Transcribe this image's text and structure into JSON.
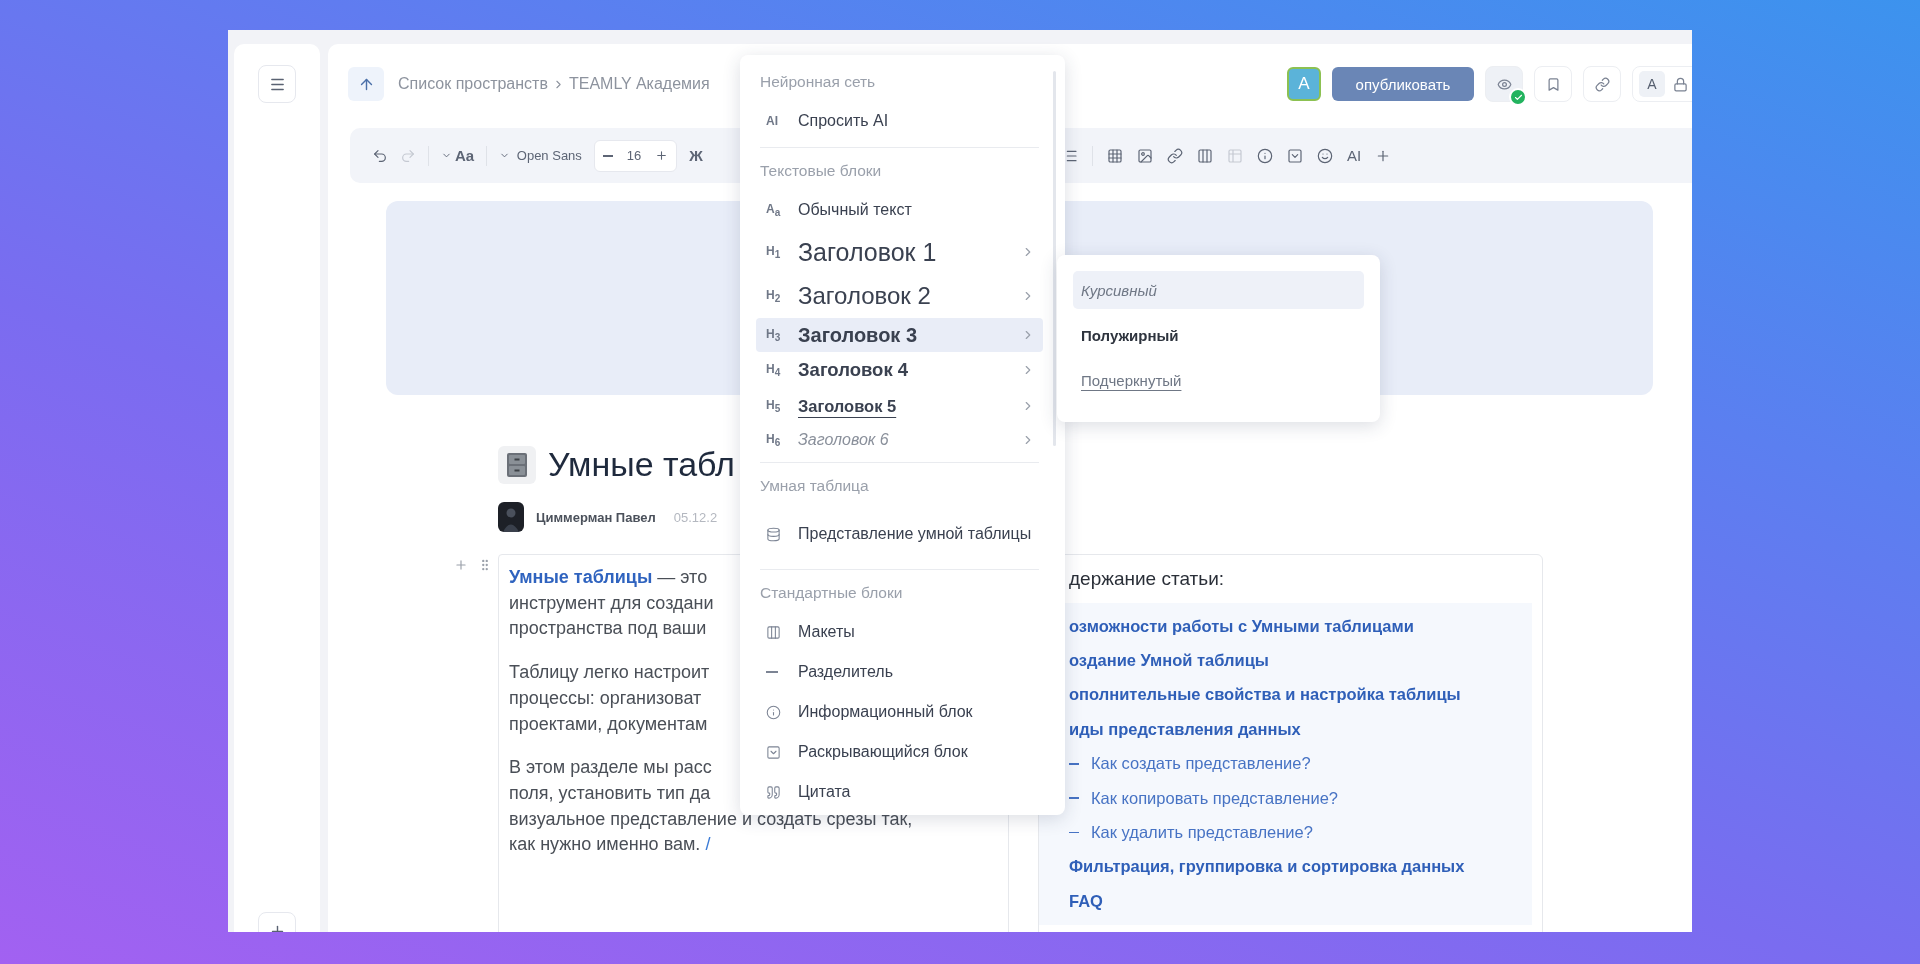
{
  "sidebar": {
    "buttons": [
      {
        "kind": "menu"
      },
      {
        "kind": "add"
      }
    ]
  },
  "breadcrumb": {
    "items": [
      "Список пространств",
      "TEAMLY Академия"
    ]
  },
  "header": {
    "avatar": "A",
    "publish": "опубликовать",
    "tools": [
      {
        "kind": "preview",
        "confirmed": true
      },
      {
        "kind": "bookmark",
        "confirmed": false
      },
      {
        "kind": "link",
        "confirmed": false
      }
    ],
    "chip": {
      "label": "A"
    }
  },
  "toolbar": {
    "left": [
      {
        "kind": "undo",
        "disabled": false
      },
      {
        "kind": "redo",
        "disabled": true
      },
      {
        "kind": "separator"
      },
      {
        "kind": "text-style",
        "label": "Aa",
        "disabled": false
      },
      {
        "kind": "separator"
      },
      {
        "kind": "font",
        "label": "Open Sans",
        "disabled": false
      },
      {
        "kind": "size",
        "value": "16",
        "disabled": false
      },
      {
        "kind": "bold",
        "label": "Ж",
        "disabled": false
      }
    ],
    "right": [
      {
        "kind": "list",
        "disabled": false
      },
      {
        "kind": "separator"
      },
      {
        "kind": "table",
        "disabled": false
      },
      {
        "kind": "image",
        "disabled": false
      },
      {
        "kind": "link",
        "disabled": false
      },
      {
        "kind": "columns",
        "disabled": false
      },
      {
        "kind": "grid",
        "disabled": true
      },
      {
        "kind": "info",
        "disabled": false
      },
      {
        "kind": "collapse",
        "disabled": false
      },
      {
        "kind": "emoji",
        "disabled": false
      },
      {
        "kind": "ai",
        "label": "AI",
        "disabled": false
      },
      {
        "kind": "plus",
        "disabled": false
      }
    ]
  },
  "article": {
    "title": "Умные табл",
    "author": "Циммерман Павел",
    "date": "05.12.2",
    "paragraphs": [
      {
        "link": "Умные таблицы",
        "lines": [
          "— это",
          "инструмент для создани",
          "пространства под ваши"
        ]
      },
      {
        "lines": [
          "Таблицу легко настроит",
          "процессы: организоват",
          "проектами, документам"
        ]
      },
      {
        "lines": [
          "В этом разделе мы расс",
          "поля, установить тип да",
          "визуальное представление и создать срезы так,",
          "как нужно именно вам."
        ],
        "typed": "/"
      }
    ]
  },
  "toc": {
    "title": "держание статьи:",
    "items": [
      {
        "label": "озможности работы с Умными таблицами"
      },
      {
        "label": "оздание Умной таблицы"
      },
      {
        "label": "ополнительные свойства и настройка таблицы"
      },
      {
        "label": "иды представления данных",
        "children": [
          {
            "label": "Как создать представление?"
          },
          {
            "label": "Как копировать представление?"
          },
          {
            "label": "Как удалить представление?"
          }
        ]
      },
      {
        "label": "Фильтрация, группировка и сортировка данных"
      },
      {
        "label": "FAQ"
      }
    ]
  },
  "block_menu": {
    "sections": [
      {
        "title": "Нейронная сеть",
        "items": [
          {
            "kind": "ai",
            "glyph": "AI",
            "label": "Спросить AI",
            "submenu": false,
            "selected": false
          }
        ]
      },
      {
        "title": "Текстовые блоки",
        "items": [
          {
            "kind": "text",
            "glyph": "A$_{a}$",
            "label": "Обычный текст",
            "submenu": false,
            "selected": false
          },
          {
            "kind": "h1",
            "glyph": "H$_{1}$",
            "label": "Заголовок 1",
            "submenu": true,
            "selected": false
          },
          {
            "kind": "h2",
            "glyph": "H$_{2}$",
            "label": "Заголовок 2",
            "submenu": true,
            "selected": false
          },
          {
            "kind": "h3",
            "glyph": "H$_{3}$",
            "label": "Заголовок 3",
            "submenu": true,
            "selected": true
          },
          {
            "kind": "h4",
            "glyph": "H$_{4}$",
            "label": "Заголовок 4",
            "submenu": true,
            "selected": false
          },
          {
            "kind": "h5",
            "glyph": "H$_{5}$",
            "label": "Заголовок 5",
            "submenu": true,
            "selected": false
          },
          {
            "kind": "h6",
            "glyph": "H$_{6}$",
            "label": "Заголовок 6",
            "submenu": true,
            "selected": false
          }
        ]
      },
      {
        "title": "Умная таблица",
        "items": [
          {
            "kind": "database",
            "label": "Представление умной таблицы",
            "submenu": false,
            "selected": false
          }
        ]
      },
      {
        "title": "Стандартные блоки",
        "items": [
          {
            "kind": "layouts",
            "label": "Макеты",
            "submenu": false,
            "selected": false
          },
          {
            "kind": "divider",
            "label": "Разделитель",
            "submenu": false,
            "selected": false
          },
          {
            "kind": "info",
            "label": "Информационный блок",
            "submenu": false,
            "selected": false
          },
          {
            "kind": "collapse",
            "label": "Раскрывающийся блок",
            "submenu": false,
            "selected": false
          },
          {
            "kind": "quote",
            "label": "Цитата",
            "submenu": false,
            "selected": false
          }
        ]
      }
    ]
  },
  "submenu": {
    "items": [
      {
        "kind": "italic",
        "label": "Курсивный",
        "selected": true
      },
      {
        "kind": "bold",
        "label": "Полужирный",
        "selected": false
      },
      {
        "kind": "underline",
        "label": "Подчеркнутый",
        "selected": false
      }
    ]
  }
}
